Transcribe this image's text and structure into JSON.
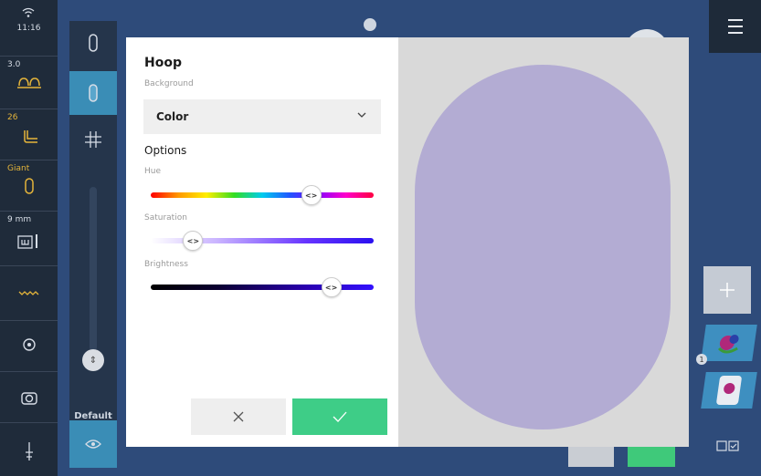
{
  "status": {
    "time": "11:16",
    "tension": "3.0",
    "foot_number": "26",
    "hoop_size": "Giant",
    "needle_size": "9 mm"
  },
  "tools": {
    "default_label": "Default"
  },
  "dialog": {
    "title": "Hoop",
    "background_label": "Background",
    "background_value": "Color",
    "options_label": "Options",
    "hue_label": "Hue",
    "saturation_label": "Saturation",
    "brightness_label": "Brightness",
    "hue_value": 0.72,
    "saturation_value": 0.19,
    "brightness_value": 0.81,
    "preview_color": "#b3acd3",
    "ok_color": "#3ecd87"
  },
  "icons": {
    "cancel": "close-icon",
    "confirm": "check-icon",
    "dropdown": "chevron-down-icon",
    "slider_knob": "<>"
  }
}
